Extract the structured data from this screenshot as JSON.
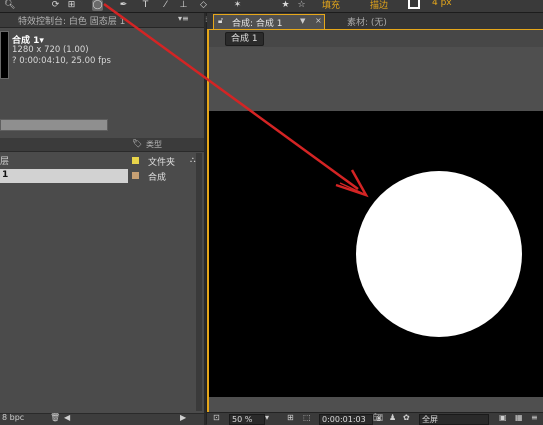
{
  "toolbar": {
    "fill_label": "填充",
    "stroke_label": "描边",
    "stroke_width": "4 px"
  },
  "effect_controls": {
    "tab_title": "特效控制台: 白色 固态层 1",
    "comp_name": "合成 1▾",
    "resolution": "1280 x 720 (1.00)",
    "duration": "? 0:00:04:10, 25.00 fps"
  },
  "project": {
    "column_type": "类型",
    "name_col_partial": "层",
    "rows": [
      {
        "name": "",
        "type": "文件夹",
        "color": "#e8d44a"
      },
      {
        "name": "1",
        "type": "合成",
        "color": "#c7a074"
      }
    ],
    "bottom_label": "8 bpc"
  },
  "composition": {
    "tab_title": "合成: 合成 1",
    "tab_menu": "▼",
    "tab_close": "×",
    "footage_title": "素材: (无)",
    "comp_button": "合成 1"
  },
  "viewer_bar": {
    "zoom": "50 %",
    "timecode": "0:00:01:03",
    "resolution": "全屏"
  },
  "colors": {
    "accent": "#e6a71a",
    "arrow": "#d42424",
    "panel": "#4b4b4b"
  }
}
